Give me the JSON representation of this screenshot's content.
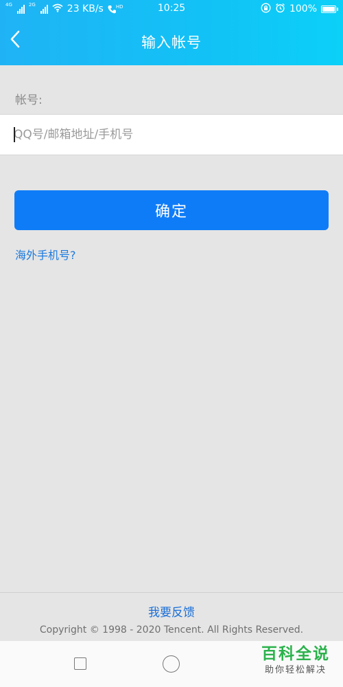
{
  "status_bar": {
    "network_left": "4G",
    "network_right": "2G",
    "speed": "23 KB/s",
    "volte": "HD",
    "time": "10:25",
    "battery": "100%",
    "battery_level": 1.0
  },
  "header": {
    "title": "输入帐号",
    "background": "#1fb3f5"
  },
  "form": {
    "account_label": "帐号:",
    "account_placeholder": "QQ号/邮箱地址/手机号",
    "account_value": "",
    "confirm_label": "确定",
    "overseas_link": "海外手机号?",
    "accent": "#0f7cf7"
  },
  "footer": {
    "feedback": "我要反馈",
    "copyright": "Copyright © 1998 - 2020 Tencent. All Rights Reserved."
  },
  "system_nav": {
    "recent_icon": "square-recent-apps-icon",
    "home_icon": "circle-home-icon"
  },
  "watermark": {
    "title": "百科全说",
    "subtitle": "助你轻松解决"
  }
}
